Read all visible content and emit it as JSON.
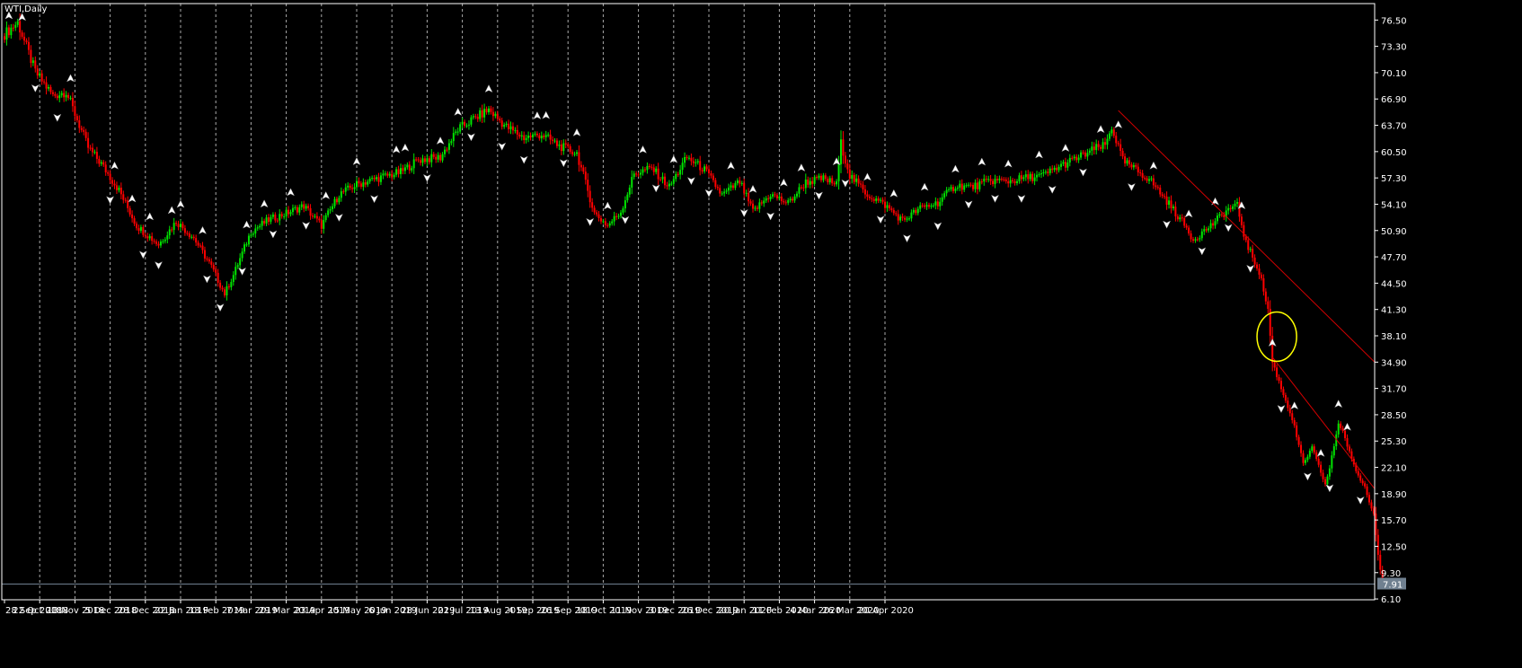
{
  "colors": {
    "background": "#000000",
    "frame": "#ffffff",
    "grid": "#c8c8c8",
    "bull": "#00e400",
    "bear": "#ff0000",
    "wick": "#d0d0d0",
    "trendline": "#d40000",
    "ellipse": "#ffff00",
    "current_price_line": "#708090",
    "price_label_bg": "#708090",
    "price_label_text": "#000000",
    "fractal": "#ffffff"
  },
  "chart_data": {
    "type": "candlestick",
    "title": "WTI,Daily",
    "ylim": [
      6.0,
      78.5
    ],
    "y_ticks": [
      "76.50",
      "73.30",
      "70.10",
      "66.90",
      "63.70",
      "60.50",
      "57.30",
      "54.10",
      "50.90",
      "47.70",
      "44.50",
      "41.30",
      "38.10",
      "34.90",
      "31.70",
      "28.50",
      "25.30",
      "22.10",
      "18.90",
      "15.70",
      "12.50",
      "9.30",
      "6.10"
    ],
    "x_ticks": [
      "28 Sep 2018",
      "22 Oct 2018",
      "13 Nov 2018",
      "5 Dec 2018",
      "28 Dec 2018",
      "22 Jan 2019",
      "13 Feb 2019",
      "7 Mar 2019",
      "29 Mar 2019",
      "23 Apr 2019",
      "15 May 2019",
      "6 Jun 2019",
      "28 Jun 2019",
      "22 Jul 2019",
      "13 Aug 2019",
      "4 Sep 2019",
      "26 Sep 2019",
      "18 Oct 2019",
      "11 Nov 2019",
      "3 Dec 2019",
      "26 Dec 2019",
      "20 Jan 2020",
      "11 Feb 2020",
      "4 Mar 2020",
      "26 Mar 2020",
      "20 Apr 2020"
    ],
    "bars_per_tick": 16,
    "current_price": "7.91",
    "close_path": [
      [
        0,
        74.8
      ],
      [
        6,
        76.2
      ],
      [
        14,
        70.2
      ],
      [
        22,
        67.3
      ],
      [
        28,
        67.8
      ],
      [
        38,
        61.0
      ],
      [
        44,
        59.0
      ],
      [
        52,
        55.8
      ],
      [
        60,
        51.5
      ],
      [
        70,
        49.2
      ],
      [
        78,
        52.0
      ],
      [
        86,
        50.0
      ],
      [
        94,
        46.5
      ],
      [
        100,
        43.2
      ],
      [
        104,
        45.5
      ],
      [
        112,
        50.8
      ],
      [
        120,
        52.2
      ],
      [
        128,
        53.0
      ],
      [
        136,
        53.9
      ],
      [
        144,
        51.5
      ],
      [
        152,
        55.3
      ],
      [
        160,
        56.5
      ],
      [
        170,
        57.3
      ],
      [
        180,
        58.0
      ],
      [
        188,
        59.5
      ],
      [
        198,
        59.8
      ],
      [
        206,
        63.2
      ],
      [
        212,
        64.3
      ],
      [
        220,
        65.6
      ],
      [
        228,
        63.5
      ],
      [
        236,
        62.2
      ],
      [
        244,
        62.6
      ],
      [
        252,
        61.2
      ],
      [
        260,
        60.3
      ],
      [
        268,
        53.0
      ],
      [
        274,
        51.5
      ],
      [
        280,
        53.2
      ],
      [
        286,
        57.8
      ],
      [
        294,
        58.5
      ],
      [
        302,
        56.2
      ],
      [
        310,
        59.8
      ],
      [
        318,
        58.3
      ],
      [
        326,
        55.2
      ],
      [
        334,
        56.8
      ],
      [
        340,
        53.2
      ],
      [
        348,
        55.3
      ],
      [
        356,
        54.2
      ],
      [
        364,
        56.8
      ],
      [
        372,
        57.2
      ],
      [
        378,
        56.5
      ],
      [
        380,
        61.5
      ],
      [
        384,
        57.6
      ],
      [
        392,
        55.3
      ],
      [
        400,
        54.0
      ],
      [
        408,
        52.1
      ],
      [
        416,
        53.6
      ],
      [
        424,
        54.3
      ],
      [
        432,
        56.4
      ],
      [
        440,
        56.2
      ],
      [
        448,
        57.0
      ],
      [
        456,
        56.9
      ],
      [
        464,
        57.3
      ],
      [
        472,
        57.6
      ],
      [
        480,
        58.8
      ],
      [
        488,
        59.8
      ],
      [
        496,
        60.9
      ],
      [
        500,
        61.2
      ],
      [
        503,
        63.5
      ],
      [
        508,
        59.4
      ],
      [
        512,
        58.6
      ],
      [
        520,
        57.2
      ],
      [
        528,
        54.5
      ],
      [
        536,
        51.6
      ],
      [
        540,
        49.8
      ],
      [
        548,
        51.5
      ],
      [
        556,
        53.5
      ],
      [
        560,
        53.9
      ],
      [
        564,
        49.4
      ],
      [
        570,
        45.9
      ],
      [
        574,
        41.3
      ],
      [
        576,
        34.9
      ],
      [
        580,
        31.7
      ],
      [
        584,
        28.8
      ],
      [
        586,
        27.0
      ],
      [
        590,
        22.5
      ],
      [
        594,
        24.5
      ],
      [
        598,
        21.5
      ],
      [
        600,
        20.0
      ],
      [
        602,
        22.0
      ],
      [
        606,
        27.5
      ],
      [
        608,
        26.5
      ],
      [
        612,
        23.0
      ],
      [
        616,
        20.5
      ],
      [
        618,
        19.8
      ],
      [
        620,
        18.0
      ],
      [
        622,
        16.5
      ],
      [
        624,
        11.5
      ],
      [
        626,
        7.91
      ]
    ],
    "fractals": [
      {
        "bar": 2,
        "type": "up"
      },
      {
        "bar": 8,
        "type": "up"
      },
      {
        "bar": 14,
        "type": "down"
      },
      {
        "bar": 24,
        "type": "down"
      },
      {
        "bar": 30,
        "type": "up"
      },
      {
        "bar": 48,
        "type": "down"
      },
      {
        "bar": 50,
        "type": "up"
      },
      {
        "bar": 58,
        "type": "up"
      },
      {
        "bar": 63,
        "type": "down"
      },
      {
        "bar": 66,
        "type": "up"
      },
      {
        "bar": 70,
        "type": "down"
      },
      {
        "bar": 76,
        "type": "up"
      },
      {
        "bar": 80,
        "type": "up"
      },
      {
        "bar": 90,
        "type": "up"
      },
      {
        "bar": 92,
        "type": "down"
      },
      {
        "bar": 98,
        "type": "down"
      },
      {
        "bar": 108,
        "type": "down"
      },
      {
        "bar": 110,
        "type": "up"
      },
      {
        "bar": 118,
        "type": "up"
      },
      {
        "bar": 122,
        "type": "down"
      },
      {
        "bar": 130,
        "type": "up"
      },
      {
        "bar": 137,
        "type": "down"
      },
      {
        "bar": 146,
        "type": "up"
      },
      {
        "bar": 152,
        "type": "down"
      },
      {
        "bar": 160,
        "type": "up"
      },
      {
        "bar": 168,
        "type": "down"
      },
      {
        "bar": 178,
        "type": "up"
      },
      {
        "bar": 182,
        "type": "up"
      },
      {
        "bar": 192,
        "type": "down"
      },
      {
        "bar": 198,
        "type": "up"
      },
      {
        "bar": 206,
        "type": "up"
      },
      {
        "bar": 212,
        "type": "down"
      },
      {
        "bar": 220,
        "type": "up"
      },
      {
        "bar": 226,
        "type": "down"
      },
      {
        "bar": 236,
        "type": "down"
      },
      {
        "bar": 242,
        "type": "up"
      },
      {
        "bar": 246,
        "type": "up"
      },
      {
        "bar": 254,
        "type": "down"
      },
      {
        "bar": 260,
        "type": "up"
      },
      {
        "bar": 266,
        "type": "down"
      },
      {
        "bar": 274,
        "type": "up"
      },
      {
        "bar": 282,
        "type": "down"
      },
      {
        "bar": 290,
        "type": "up"
      },
      {
        "bar": 296,
        "type": "down"
      },
      {
        "bar": 304,
        "type": "up"
      },
      {
        "bar": 312,
        "type": "down"
      },
      {
        "bar": 320,
        "type": "down"
      },
      {
        "bar": 330,
        "type": "up"
      },
      {
        "bar": 336,
        "type": "down"
      },
      {
        "bar": 340,
        "type": "up"
      },
      {
        "bar": 348,
        "type": "down"
      },
      {
        "bar": 354,
        "type": "up"
      },
      {
        "bar": 362,
        "type": "up"
      },
      {
        "bar": 370,
        "type": "down"
      },
      {
        "bar": 378,
        "type": "up"
      },
      {
        "bar": 382,
        "type": "down"
      },
      {
        "bar": 392,
        "type": "up"
      },
      {
        "bar": 398,
        "type": "down"
      },
      {
        "bar": 404,
        "type": "up"
      },
      {
        "bar": 410,
        "type": "down"
      },
      {
        "bar": 418,
        "type": "up"
      },
      {
        "bar": 424,
        "type": "down"
      },
      {
        "bar": 432,
        "type": "up"
      },
      {
        "bar": 438,
        "type": "down"
      },
      {
        "bar": 444,
        "type": "up"
      },
      {
        "bar": 450,
        "type": "down"
      },
      {
        "bar": 456,
        "type": "up"
      },
      {
        "bar": 462,
        "type": "down"
      },
      {
        "bar": 470,
        "type": "up"
      },
      {
        "bar": 476,
        "type": "down"
      },
      {
        "bar": 482,
        "type": "up"
      },
      {
        "bar": 490,
        "type": "down"
      },
      {
        "bar": 498,
        "type": "up"
      },
      {
        "bar": 506,
        "type": "up"
      },
      {
        "bar": 512,
        "type": "down"
      },
      {
        "bar": 522,
        "type": "up"
      },
      {
        "bar": 528,
        "type": "down"
      },
      {
        "bar": 538,
        "type": "up"
      },
      {
        "bar": 544,
        "type": "down"
      },
      {
        "bar": 550,
        "type": "up"
      },
      {
        "bar": 556,
        "type": "down"
      },
      {
        "bar": 562,
        "type": "up"
      },
      {
        "bar": 566,
        "type": "down"
      },
      {
        "bar": 576,
        "type": "up"
      },
      {
        "bar": 580,
        "type": "down"
      },
      {
        "bar": 586,
        "type": "up"
      },
      {
        "bar": 592,
        "type": "down"
      },
      {
        "bar": 598,
        "type": "up"
      },
      {
        "bar": 602,
        "type": "down"
      },
      {
        "bar": 606,
        "type": "up"
      },
      {
        "bar": 610,
        "type": "up"
      },
      {
        "bar": 616,
        "type": "down"
      }
    ],
    "trendlines": [
      {
        "from": {
          "bar": 506,
          "price": 65.5
        },
        "to": {
          "bar": 637,
          "price": 34.9
        }
      },
      {
        "from": {
          "bar": 576,
          "price": 35.5
        },
        "to": {
          "bar": 637,
          "price": 19.5
        }
      }
    ],
    "annotations": [
      {
        "type": "ellipse",
        "bar": 578,
        "price": 38.0,
        "rx_bars": 4.5,
        "ry_price": 3.0
      }
    ]
  }
}
